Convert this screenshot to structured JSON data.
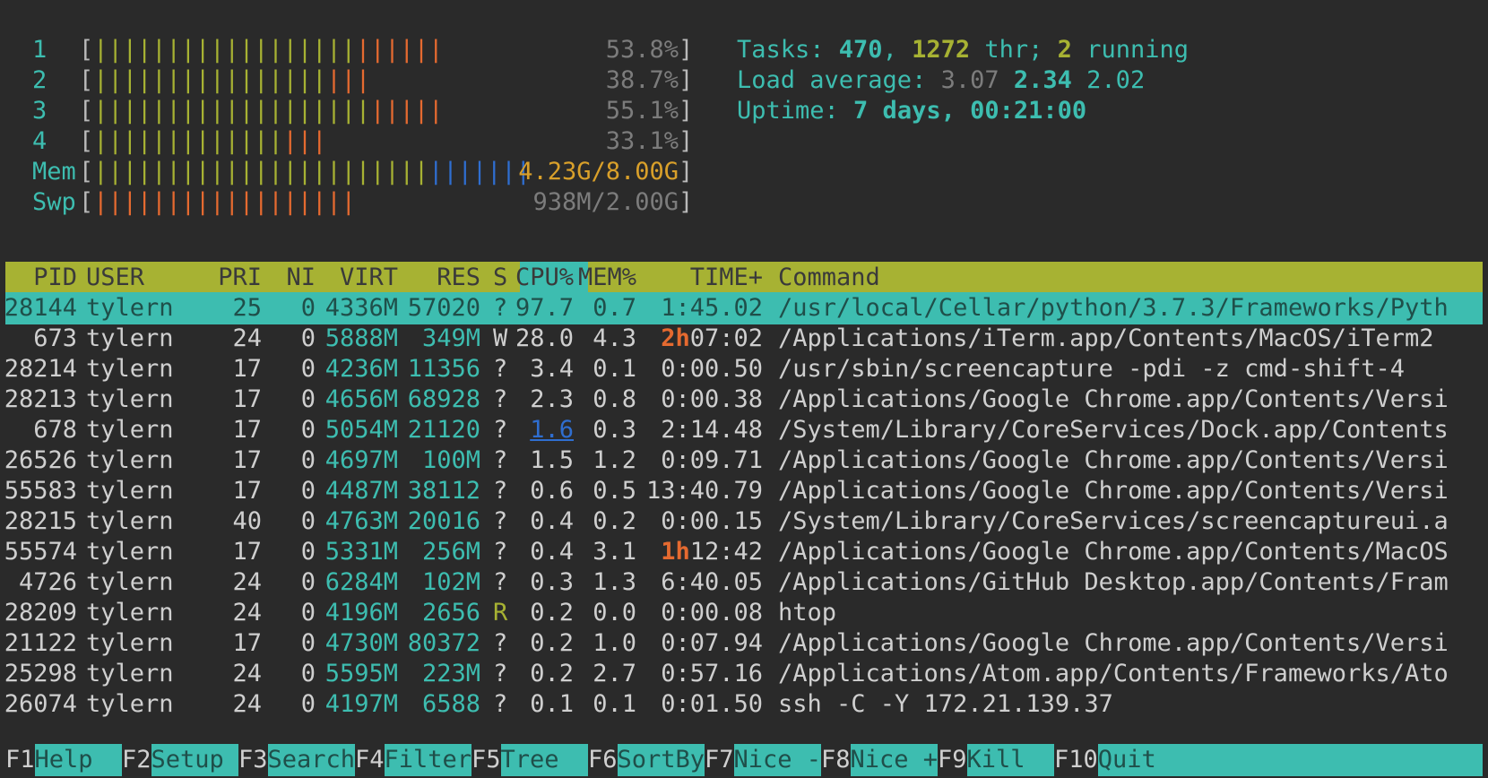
{
  "meters": [
    {
      "label": "1",
      "green": "||||||||||||||||||",
      "orange": "||||||",
      "blue": "",
      "value": "53.8%"
    },
    {
      "label": "2",
      "green": "||||||||||||||||",
      "orange": "|||",
      "blue": "",
      "value": "38.7%"
    },
    {
      "label": "3",
      "green": "|||||||||||||||||||",
      "orange": "|||||",
      "blue": "",
      "value": "55.1%"
    },
    {
      "label": "4",
      "green": "|||||||||||||",
      "orange": "|||",
      "blue": "",
      "value": "33.1%"
    }
  ],
  "mem": {
    "label": "Mem",
    "green": "|||||||||||||||||||||||",
    "blue": "|||||||",
    "orange": "",
    "value": "4.23G/8.00G"
  },
  "swp": {
    "label": "Swp",
    "orange": "||||||||||||||||||",
    "value": "938M/2.00G"
  },
  "info": {
    "tasks_label": "Tasks: ",
    "tasks": "470",
    "sep1": ", ",
    "threads": "1272",
    "thr_label": " thr; ",
    "running": "2",
    "running_label": " running",
    "load_label": "Load average: ",
    "load1": "3.07",
    "load5": "2.34",
    "load15": "2.02",
    "uptime_label": "Uptime: ",
    "uptime": "7 days, 00:21:00"
  },
  "columns": [
    "PID",
    "USER",
    "PRI",
    "NI",
    "VIRT",
    "RES",
    "S",
    "CPU%",
    "MEM%",
    "TIME+",
    "Command"
  ],
  "processes": [
    {
      "pid": "28144",
      "user": "tylern",
      "pri": "25",
      "ni": "0",
      "virt": "4336M",
      "res": "57020",
      "s": "?",
      "cpu": "97.7",
      "mem": "0.7",
      "time": "1:45.02",
      "time_hi": "",
      "cmd": "/usr/local/Cellar/python/3.7.3/Frameworks/Pyth"
    },
    {
      "pid": "673",
      "user": "tylern",
      "pri": "24",
      "ni": "0",
      "virt": "5888M",
      "res": "349M",
      "s": "W",
      "cpu": "28.0",
      "mem": "4.3",
      "time": "07:02",
      "time_hi": "2h",
      "cmd": "/Applications/iTerm.app/Contents/MacOS/iTerm2"
    },
    {
      "pid": "28214",
      "user": "tylern",
      "pri": "17",
      "ni": "0",
      "virt": "4236M",
      "res": "11356",
      "s": "?",
      "cpu": "3.4",
      "mem": "0.1",
      "time": "0:00.50",
      "time_hi": "",
      "cmd": "/usr/sbin/screencapture -pdi -z cmd-shift-4"
    },
    {
      "pid": "28213",
      "user": "tylern",
      "pri": "17",
      "ni": "0",
      "virt": "4656M",
      "res": "68928",
      "s": "?",
      "cpu": "2.3",
      "mem": "0.8",
      "time": "0:00.38",
      "time_hi": "",
      "cmd": "/Applications/Google Chrome.app/Contents/Versi"
    },
    {
      "pid": "678",
      "user": "tylern",
      "pri": "17",
      "ni": "0",
      "virt": "5054M",
      "res": "21120",
      "s": "?",
      "cpu": "1.6",
      "mem": "0.3",
      "time": "2:14.48",
      "time_hi": "",
      "cmd": "/System/Library/CoreServices/Dock.app/Contents"
    },
    {
      "pid": "26526",
      "user": "tylern",
      "pri": "17",
      "ni": "0",
      "virt": "4697M",
      "res": "100M",
      "s": "?",
      "cpu": "1.5",
      "mem": "1.2",
      "time": "0:09.71",
      "time_hi": "",
      "cmd": "/Applications/Google Chrome.app/Contents/Versi"
    },
    {
      "pid": "55583",
      "user": "tylern",
      "pri": "17",
      "ni": "0",
      "virt": "4487M",
      "res": "38112",
      "s": "?",
      "cpu": "0.6",
      "mem": "0.5",
      "time": "13:40.79",
      "time_hi": "",
      "cmd": "/Applications/Google Chrome.app/Contents/Versi"
    },
    {
      "pid": "28215",
      "user": "tylern",
      "pri": "40",
      "ni": "0",
      "virt": "4763M",
      "res": "20016",
      "s": "?",
      "cpu": "0.4",
      "mem": "0.2",
      "time": "0:00.15",
      "time_hi": "",
      "cmd": "/System/Library/CoreServices/screencaptureui.a"
    },
    {
      "pid": "55574",
      "user": "tylern",
      "pri": "17",
      "ni": "0",
      "virt": "5331M",
      "res": "256M",
      "s": "?",
      "cpu": "0.4",
      "mem": "3.1",
      "time": "12:42",
      "time_hi": "1h",
      "cmd": "/Applications/Google Chrome.app/Contents/MacOS"
    },
    {
      "pid": "4726",
      "user": "tylern",
      "pri": "24",
      "ni": "0",
      "virt": "6284M",
      "res": "102M",
      "s": "?",
      "cpu": "0.3",
      "mem": "1.3",
      "time": "6:40.05",
      "time_hi": "",
      "cmd": "/Applications/GitHub Desktop.app/Contents/Fram"
    },
    {
      "pid": "28209",
      "user": "tylern",
      "pri": "24",
      "ni": "0",
      "virt": "4196M",
      "res": "2656",
      "s": "R",
      "cpu": "0.2",
      "mem": "0.0",
      "time": "0:00.08",
      "time_hi": "",
      "cmd": "htop"
    },
    {
      "pid": "21122",
      "user": "tylern",
      "pri": "17",
      "ni": "0",
      "virt": "4730M",
      "res": "80372",
      "s": "?",
      "cpu": "0.2",
      "mem": "1.0",
      "time": "0:07.94",
      "time_hi": "",
      "cmd": "/Applications/Google Chrome.app/Contents/Versi"
    },
    {
      "pid": "25298",
      "user": "tylern",
      "pri": "24",
      "ni": "0",
      "virt": "5595M",
      "res": "223M",
      "s": "?",
      "cpu": "0.2",
      "mem": "2.7",
      "time": "0:57.16",
      "time_hi": "",
      "cmd": "/Applications/Atom.app/Contents/Frameworks/Ato"
    },
    {
      "pid": "26074",
      "user": "tylern",
      "pri": "24",
      "ni": "0",
      "virt": "4197M",
      "res": "6588",
      "s": "?",
      "cpu": "0.1",
      "mem": "0.1",
      "time": "0:01.50",
      "time_hi": "",
      "cmd": "ssh -C -Y 172.21.139.37"
    }
  ],
  "footer": [
    {
      "key": "F1",
      "label": "Help"
    },
    {
      "key": "F2",
      "label": "Setup"
    },
    {
      "key": "F3",
      "label": "Search"
    },
    {
      "key": "F4",
      "label": "Filter"
    },
    {
      "key": "F5",
      "label": "Tree"
    },
    {
      "key": "F6",
      "label": "SortBy"
    },
    {
      "key": "F7",
      "label": "Nice -"
    },
    {
      "key": "F8",
      "label": "Nice +"
    },
    {
      "key": "F9",
      "label": "Kill"
    },
    {
      "key": "F10",
      "label": "Quit"
    }
  ]
}
